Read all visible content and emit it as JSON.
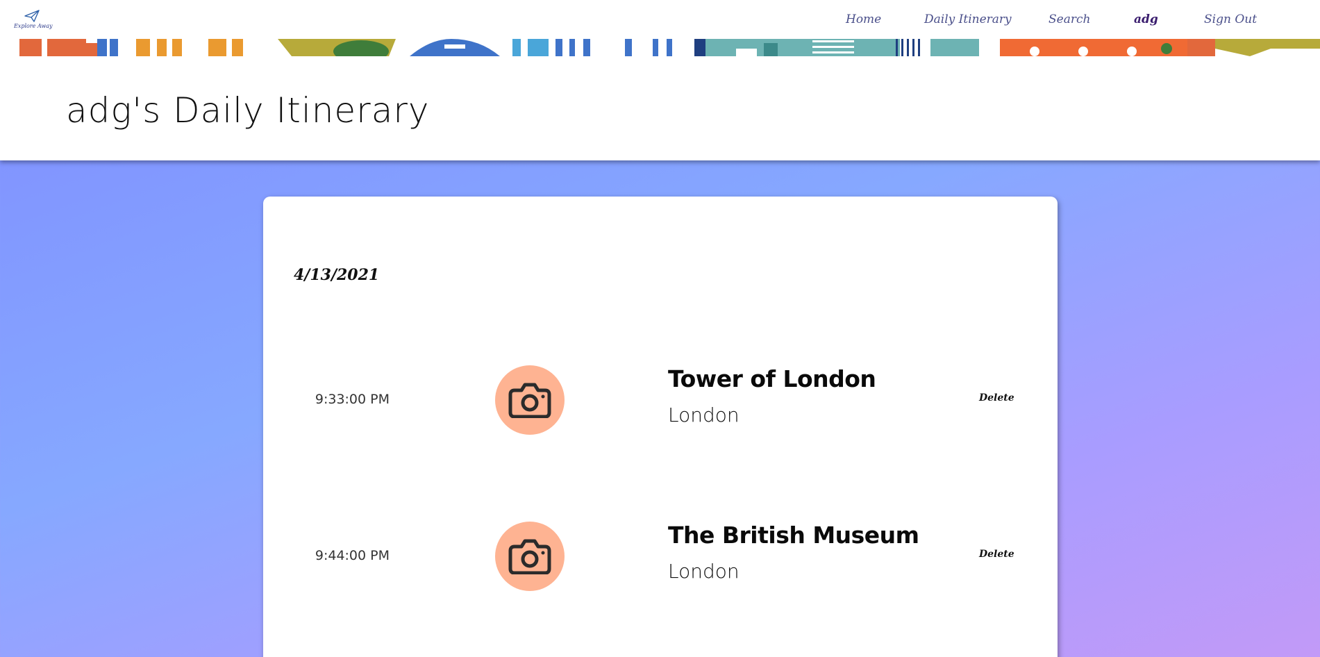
{
  "brand": {
    "logo_text": "Explore Away"
  },
  "nav": {
    "home": "Home",
    "itinerary": "Daily Itinerary",
    "search": "Search",
    "user": "adg",
    "signout": "Sign Out"
  },
  "page": {
    "title": "adg's Daily Itinerary"
  },
  "itinerary": {
    "date": "4/13/2021",
    "delete_label": "Delete",
    "entries": [
      {
        "time": "9:33:00 PM",
        "name": "Tower of London",
        "city": "London",
        "icon": "camera-icon"
      },
      {
        "time": "9:44:00 PM",
        "name": "The British Museum",
        "city": "London",
        "icon": "camera-icon"
      }
    ]
  },
  "colors": {
    "photo_circle": "#feb392",
    "nav_text": "#4a4f8a",
    "nav_active": "#3a1d6e",
    "background_gradient": [
      "#7f8cff",
      "#86a8ff",
      "#c29af7"
    ]
  }
}
